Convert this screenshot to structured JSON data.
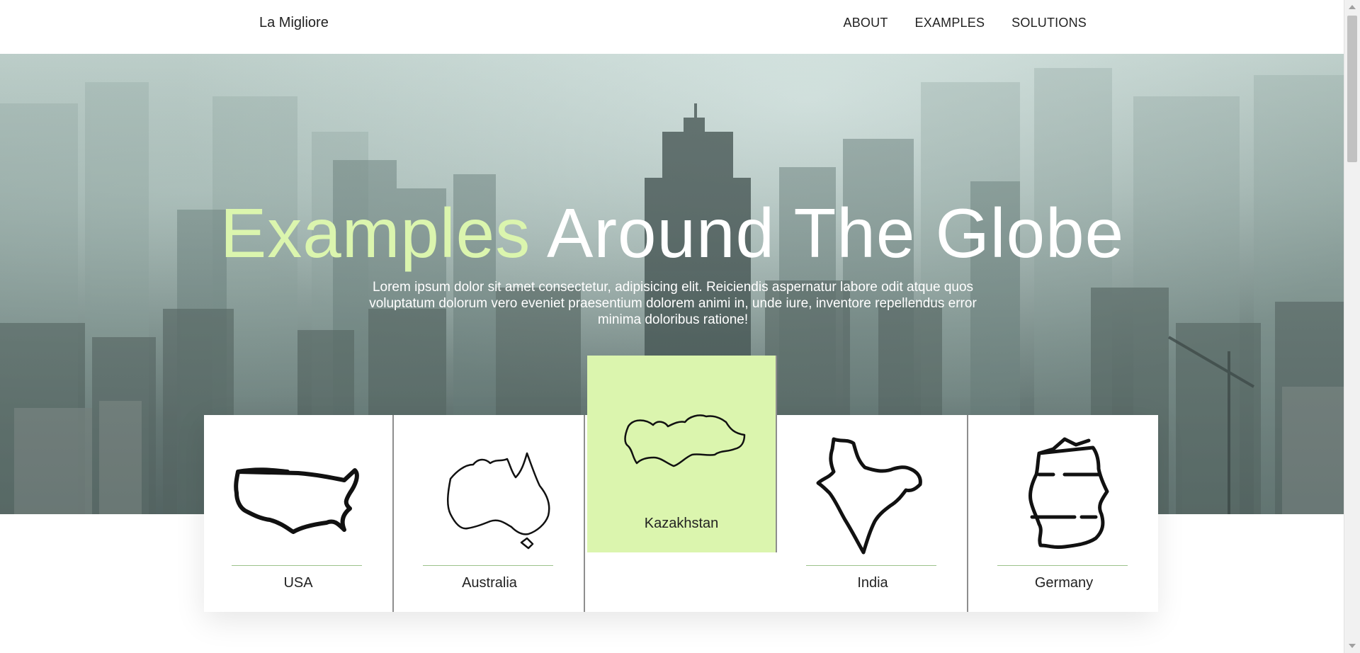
{
  "header": {
    "brand": "La Migliore",
    "nav": [
      "ABOUT",
      "EXAMPLES",
      "SOLUTIONS"
    ]
  },
  "hero": {
    "title_accent": "Examples",
    "title_rest": " Around The Globe",
    "description": "Lorem ipsum dolor sit amet consectetur, adipisicing elit. Reiciendis aspernatur labore odit atque quos voluptatum dolorum vero eveniet praesentium dolorem animi in, unde iure, inventore repellendus error minima doloribus ratione!"
  },
  "countries": [
    {
      "label": "USA",
      "icon": "usa-map-icon",
      "active": false
    },
    {
      "label": "Australia",
      "icon": "australia-map-icon",
      "active": false
    },
    {
      "label": "Kazakhstan",
      "icon": "kazakhstan-map-icon",
      "active": true
    },
    {
      "label": "India",
      "icon": "india-map-icon",
      "active": false
    },
    {
      "label": "Germany",
      "icon": "germany-map-icon",
      "active": false
    }
  ],
  "colors": {
    "accent": "#dbf5ae",
    "divider": "#9bc28a",
    "text": "#222222"
  }
}
